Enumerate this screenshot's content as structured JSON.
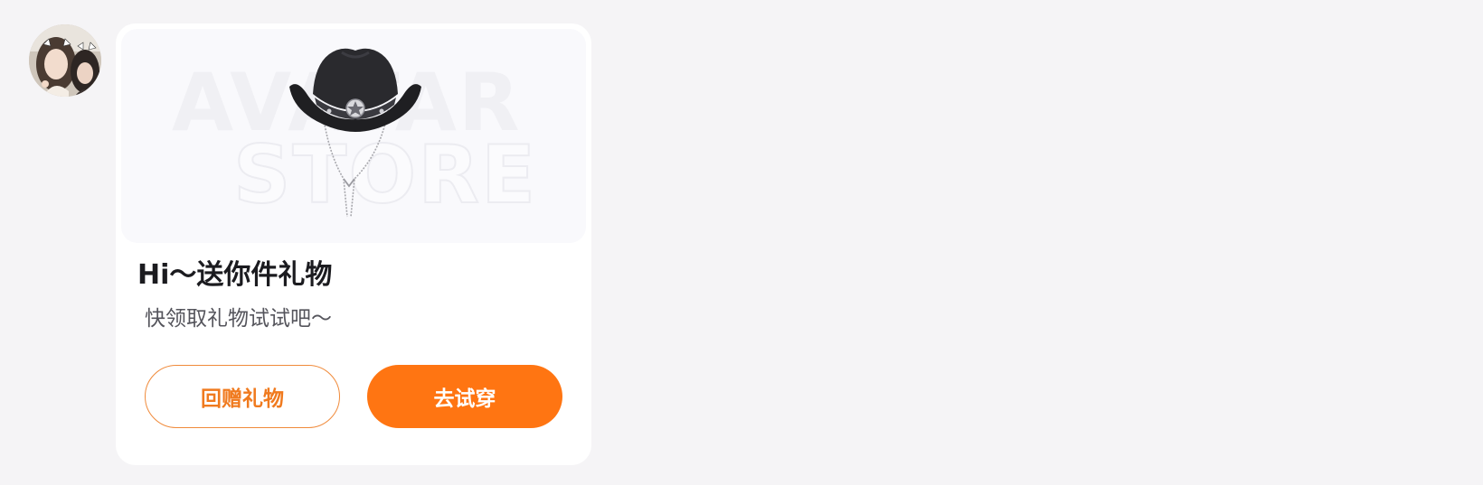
{
  "sender": {
    "avatar_icon": "user-avatar-photo"
  },
  "gift_card": {
    "banner": {
      "watermark_line1": "AVATAR",
      "watermark_line2": "STORE",
      "item_icon": "cowboy-hat-icon"
    },
    "title": "Hi～送你件礼物",
    "subtitle": "快领取礼物试试吧～",
    "buttons": {
      "return_gift": "回赠礼物",
      "try_on": "去试穿"
    }
  },
  "colors": {
    "accent": "#ff7512",
    "outline_button_text": "#f07a1e",
    "page_background": "#f5f4f6",
    "card_background": "#ffffff"
  }
}
